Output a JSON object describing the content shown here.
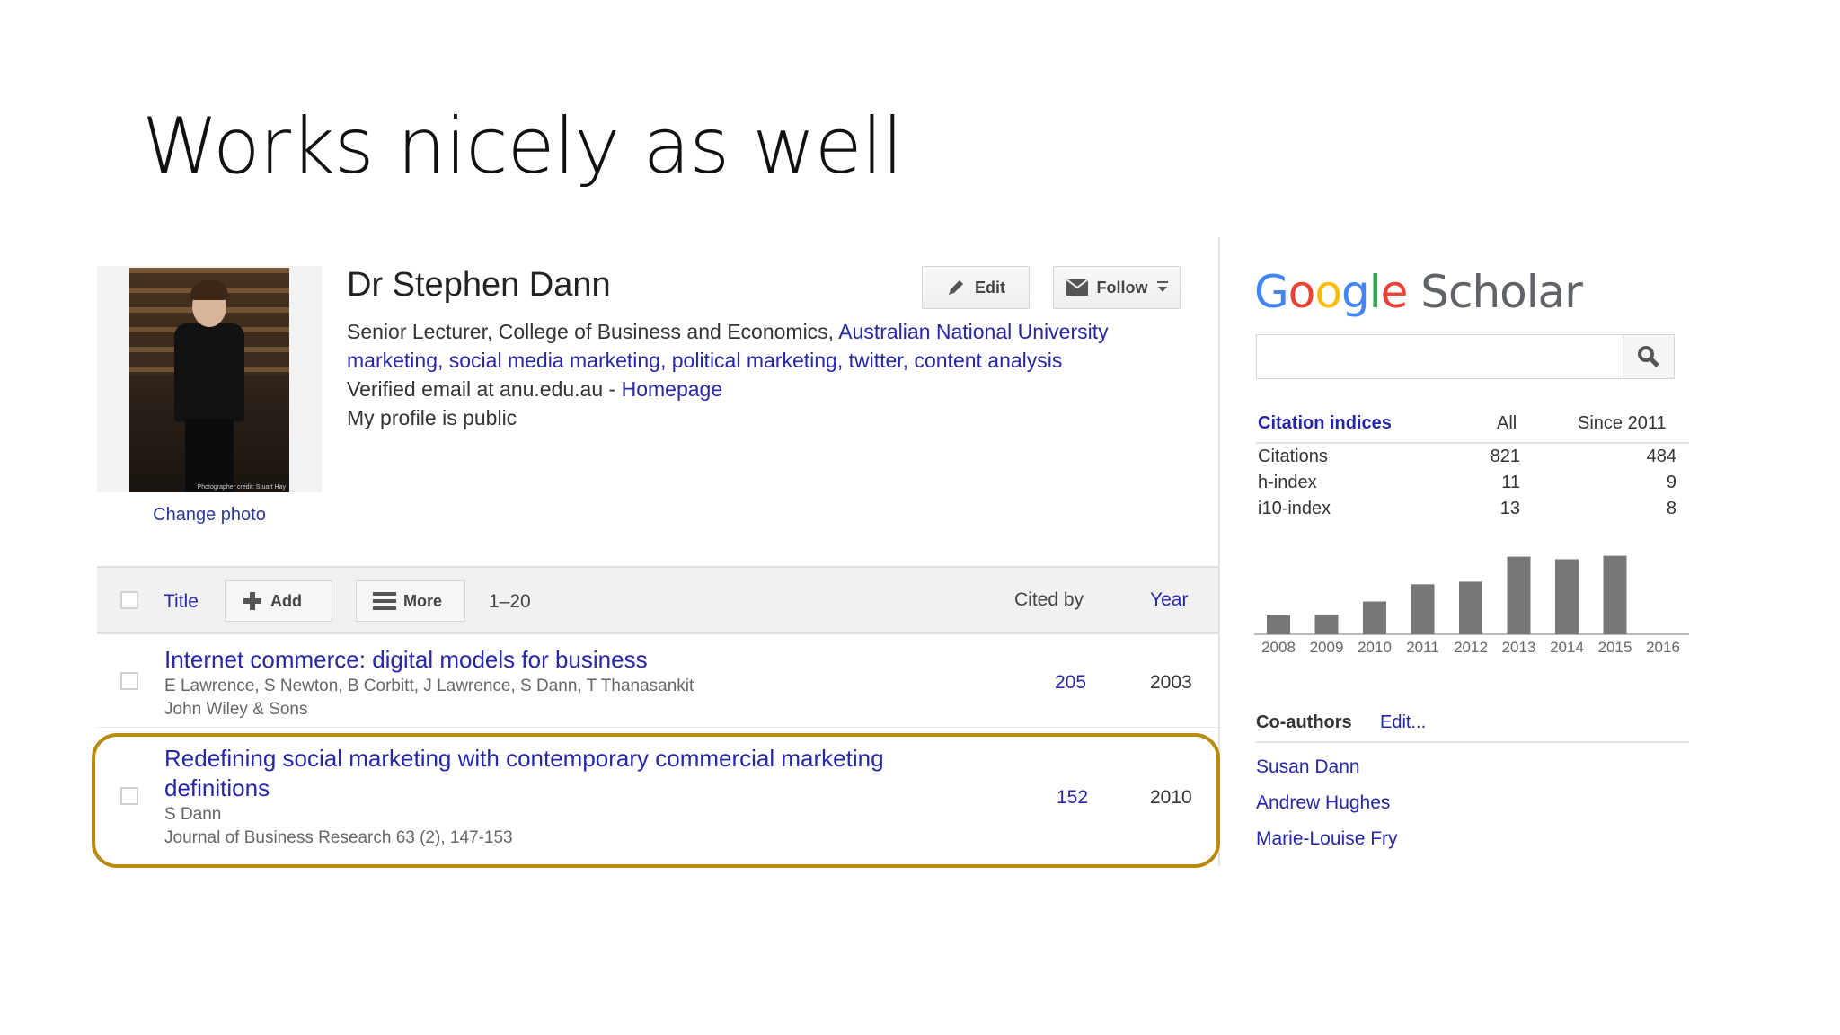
{
  "slide": {
    "title": "Works nicely as well"
  },
  "profile": {
    "change_photo": "Change photo",
    "photo_credit": "Photographer credit: Stuart Hay",
    "name": "Dr Stephen Dann",
    "affiliation_text": "Senior Lecturer, College of Business and Economics, ",
    "affiliation_link": "Australian National University",
    "interests": "marketing, social media marketing, political marketing, twitter, content analysis",
    "email_text": "Verified email at anu.edu.au - ",
    "homepage_link": "Homepage",
    "visibility": "My profile is public",
    "edit_label": "Edit",
    "follow_label": "Follow"
  },
  "table": {
    "title_header": "Title",
    "add_label": "Add",
    "more_label": "More",
    "range": "1–20",
    "cited_by_header": "Cited by",
    "year_header": "Year",
    "rows": [
      {
        "title_line1": "Internet commerce: digital models for business",
        "title_line2": "",
        "authors": "E Lawrence, S Newton, B Corbitt, J Lawrence, S Dann, T Thanasankit",
        "venue": "John Wiley & Sons",
        "cited_by": "205",
        "year": "2003"
      },
      {
        "title_line1": "Redefining social marketing with contemporary commercial marketing",
        "title_line2": "definitions",
        "authors": "S Dann",
        "venue": "Journal of Business Research 63 (2), 147-153",
        "cited_by": "152",
        "year": "2010"
      }
    ]
  },
  "scholar": {
    "logo_google": "Google",
    "logo_scholar": "Scholar",
    "search_placeholder": "",
    "colors": {
      "blue": "#4285f4",
      "red": "#ea4335",
      "yellow": "#fbbc05",
      "green": "#34a853",
      "scholar_grey": "#5f6368",
      "highlight": "#b98a0e"
    }
  },
  "citations": {
    "header": "Citation indices",
    "col_all": "All",
    "col_since": "Since 2011",
    "rows": [
      {
        "label": "Citations",
        "all": "821",
        "since": "484"
      },
      {
        "label": "h-index",
        "all": "11",
        "since": "9"
      },
      {
        "label": "i10-index",
        "all": "13",
        "since": "8"
      }
    ]
  },
  "chart_data": {
    "type": "bar",
    "categories": [
      "2008",
      "2009",
      "2010",
      "2011",
      "2012",
      "2013",
      "2014",
      "2015",
      "2016"
    ],
    "values": [
      22,
      23,
      38,
      58,
      61,
      90,
      87,
      91,
      0
    ],
    "title": "",
    "xlabel": "",
    "ylabel": "",
    "ylim": [
      0,
      100
    ],
    "color": "#777777"
  },
  "coauthors": {
    "header": "Co-authors",
    "edit_label": "Edit...",
    "items": [
      "Susan Dann",
      "Andrew Hughes",
      "Marie-Louise Fry"
    ]
  }
}
